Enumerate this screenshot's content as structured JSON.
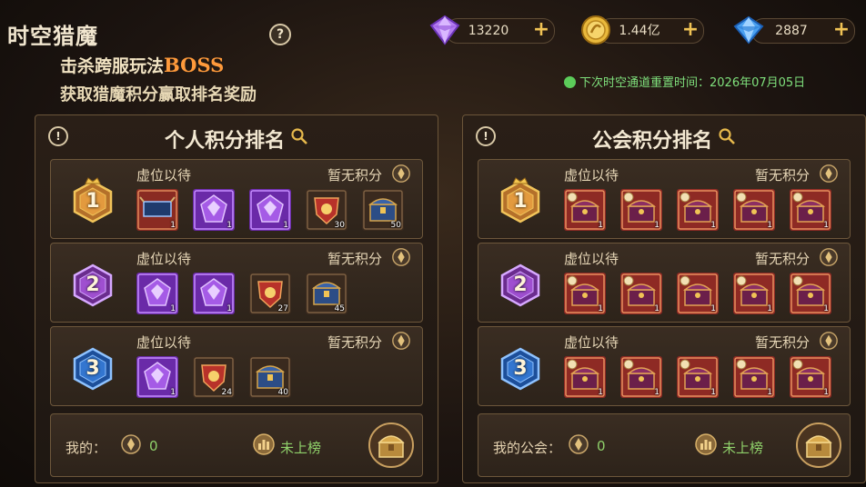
{
  "header": {
    "title": "时空猎魔",
    "help_label": "?",
    "subtitle_line1_prefix": "击杀跨服玩法",
    "subtitle_line1_boss": "BOSS",
    "subtitle_line2": "获取猎魔积分赢取排名奖励",
    "reset_text": "下次时空通道重置时间：2026年07月05日"
  },
  "currencies": [
    {
      "name": "purple-diamond",
      "value": "13220",
      "plus": "+"
    },
    {
      "name": "gold-coin",
      "value": "1.44亿",
      "plus": "+"
    },
    {
      "name": "blue-diamond",
      "value": "2887",
      "plus": "+"
    }
  ],
  "panels": [
    {
      "title": "个人积分排名",
      "info_label": "!",
      "rows": [
        {
          "rank": "1",
          "vacant": "虚位以待",
          "score": "暂无积分",
          "items": [
            {
              "type": "wings-blue",
              "count": "1"
            },
            {
              "type": "purple-gem",
              "count": "1"
            },
            {
              "type": "purple-gem",
              "count": "1"
            },
            {
              "type": "red-emblem",
              "count": "30"
            },
            {
              "type": "blue-chest",
              "count": "50"
            }
          ]
        },
        {
          "rank": "2",
          "vacant": "虚位以待",
          "score": "暂无积分",
          "items": [
            {
              "type": "purple-gem",
              "count": "1"
            },
            {
              "type": "purple-gem",
              "count": "1"
            },
            {
              "type": "red-emblem",
              "count": "27"
            },
            {
              "type": "blue-chest",
              "count": "45"
            }
          ]
        },
        {
          "rank": "3",
          "vacant": "虚位以待",
          "score": "暂无积分",
          "items": [
            {
              "type": "purple-gem",
              "count": "1"
            },
            {
              "type": "red-emblem",
              "count": "24"
            },
            {
              "type": "blue-chest",
              "count": "40"
            }
          ]
        }
      ],
      "mine_label": "我的：",
      "mine_value": "0",
      "rank_status": "未上榜"
    },
    {
      "title": "公会积分排名",
      "info_label": "!",
      "rows": [
        {
          "rank": "1",
          "vacant": "虚位以待",
          "score": "暂无积分",
          "items": [
            {
              "type": "red-chest",
              "count": "1"
            },
            {
              "type": "red-chest",
              "count": "1"
            },
            {
              "type": "red-chest",
              "count": "1"
            },
            {
              "type": "red-chest",
              "count": "1"
            },
            {
              "type": "red-chest",
              "count": "1"
            }
          ]
        },
        {
          "rank": "2",
          "vacant": "虚位以待",
          "score": "暂无积分",
          "items": [
            {
              "type": "red-chest",
              "count": "1"
            },
            {
              "type": "red-chest",
              "count": "1"
            },
            {
              "type": "red-chest",
              "count": "1"
            },
            {
              "type": "red-chest",
              "count": "1"
            },
            {
              "type": "red-chest",
              "count": "1"
            }
          ]
        },
        {
          "rank": "3",
          "vacant": "虚位以待",
          "score": "暂无积分",
          "items": [
            {
              "type": "red-chest",
              "count": "1"
            },
            {
              "type": "red-chest",
              "count": "1"
            },
            {
              "type": "red-chest",
              "count": "1"
            },
            {
              "type": "red-chest",
              "count": "1"
            },
            {
              "type": "red-chest",
              "count": "1"
            }
          ]
        }
      ],
      "mine_label": "我的公会：",
      "mine_value": "0",
      "rank_status": "未上榜"
    }
  ]
}
